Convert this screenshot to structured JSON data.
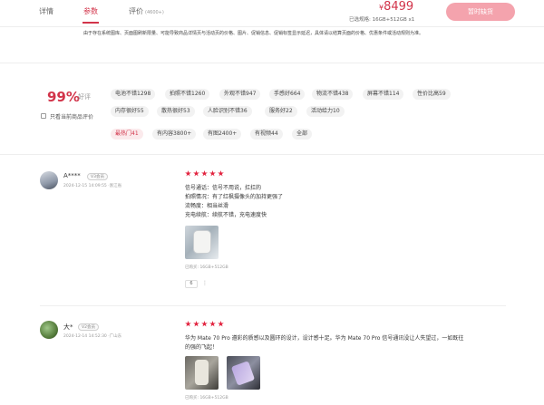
{
  "tabs": [
    {
      "label": "详情"
    },
    {
      "label": "参数"
    },
    {
      "label": "评价",
      "count": "(4600+)"
    }
  ],
  "purchase": {
    "currency": "¥",
    "price": "8499",
    "spec": "已选规格: 16GB+512GB x1",
    "buy_label": "暂时缺货"
  },
  "notice": "由于存在系统图库、页面图刷新限量、可能导致商品详情页与活动页的价格、图片、促销信息、促销标签显示延迟，具体请以结算页面的价格、优惠条件或活动规则为准。",
  "rating": {
    "percent": "99%",
    "label": "好评",
    "only_current_label": "只看当前商品评价",
    "accent": "#d2344a"
  },
  "tags": [
    "电池不错1298",
    "拍照不错1260",
    "外观不错947",
    "手感好664",
    "物流不错438",
    "屏幕不错114",
    "性价比高59",
    "内存很好55",
    "散热很好53",
    "人脸识别不错36",
    "服务好22",
    "活动给力10"
  ],
  "filters": [
    "最热门41",
    "有内容3800+",
    "有图2400+",
    "有视频44",
    "全部"
  ],
  "reviews": [
    {
      "user": "A****",
      "vip": "V3会员",
      "meta": "2024-12-15 14:09:55 ·浙江省",
      "stars": 5,
      "lines": [
        "信号通话：信号不用说，扛扛的",
        "拍照情况：有了红枫摄像头的加持更强了",
        "流畅度：相当丝滑",
        "充电续航：续航不错，充电速度快"
      ],
      "sku": "已购买: 16GB+512GB",
      "likes": "6",
      "more": "⋮"
    },
    {
      "user": "大*",
      "vip": "V2会员",
      "meta": "2024-12-14 14:52:30 ·广山东",
      "stars": 5,
      "lines": [
        "华为 Mate 70 Pro 遵彩的质感以及圆环的设计，设计感十足。华为 Mate 70 Pro 信号通讯没让人失望过，一如既往",
        "的强的飞起！"
      ],
      "sku": "已购买: 16GB+512GB"
    }
  ]
}
